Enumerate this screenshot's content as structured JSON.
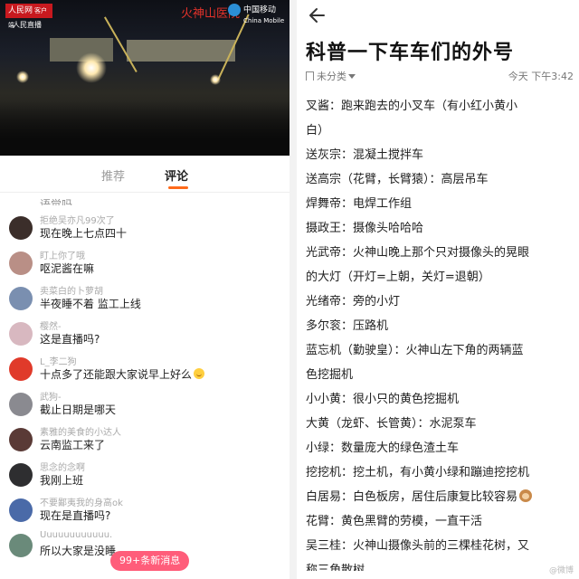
{
  "video": {
    "logo_rmw": "人民网",
    "logo_client": "客户端",
    "logo_live": "人民直播",
    "logo_caption": "火神山医院",
    "carrier_name": "中国移动",
    "carrier_en": "China Mobile"
  },
  "tabs": {
    "recommend": "推荐",
    "comments": "评论"
  },
  "comments_cut_text": "语觉吗",
  "comments": [
    {
      "name": "拒绝吴亦凡99次了",
      "text": "现在晚上七点四十",
      "avatar_color": "#3b2e2a"
    },
    {
      "name": "盯上你了哦",
      "text": "呕泥酱在嘛",
      "avatar_color": "#b98f86"
    },
    {
      "name": "卖菜白的卜萝胡",
      "text": "半夜睡不着 监工上线",
      "avatar_color": "#7a8fb0"
    },
    {
      "name": "樱然-",
      "text": "这是直播吗?",
      "avatar_color": "#d8b8c0"
    },
    {
      "name": "L_李二狗",
      "text": "十点多了还能跟大家说早上好么",
      "avatar_color": "#e03a2a",
      "emoji": true
    },
    {
      "name": "武狗-",
      "text": "截止日期是哪天",
      "avatar_color": "#8a8a90"
    },
    {
      "name": "素雅的美食的小达人",
      "text": "云南监工来了",
      "avatar_color": "#5a3a36"
    },
    {
      "name": "思念的念啊",
      "text": "我刚上班",
      "avatar_color": "#2e2e30"
    },
    {
      "name": "不要鄙夷我的身高ok",
      "text": "现在是直播吗?",
      "avatar_color": "#4a6aa8"
    },
    {
      "name": "Uuuuuuuuuuuu.",
      "text": "所以大家是没睡",
      "avatar_color": "#6a8a7a"
    }
  ],
  "new_messages": "99+条新消息",
  "article": {
    "title": "科普一下车车们的外号",
    "category": "未分类",
    "time": "今天 下午3:42",
    "lines": [
      "叉酱：跑来跑去的小叉车（有小红小黄小",
      "白）",
      "送灰宗：混凝土搅拌车",
      "送高宗（花臂，长臂猿）：高层吊车",
      "焊舞帝：电焊工作组",
      "摄政王：摄像头哈哈哈",
      "光武帝：火神山晚上那个只对摄像头的晃眼",
      "的大灯（开灯=上朝，关灯=退朝）",
      "光绪帝：旁的小灯",
      "多尔衮：压路机",
      "蓝忘机（勤驶皇）：火神山左下角的两辆蓝",
      "色挖掘机",
      "小小黄：很小只的黄色挖掘机",
      "大黄（龙虾、长管黄）：水泥泵车",
      "小绿：数量庞大的绿色渣土车",
      "挖挖机：挖土机，有小黄小绿和蹦迪挖挖机",
      "白居易：白色板房，居住后康复比较容易",
      "花臂：黄色黑臂的劳模，一直干活",
      "吴三桂：火神山摄像头前的三棵桂花树，又",
      "称三角散树"
    ]
  },
  "watermark": "@微博"
}
